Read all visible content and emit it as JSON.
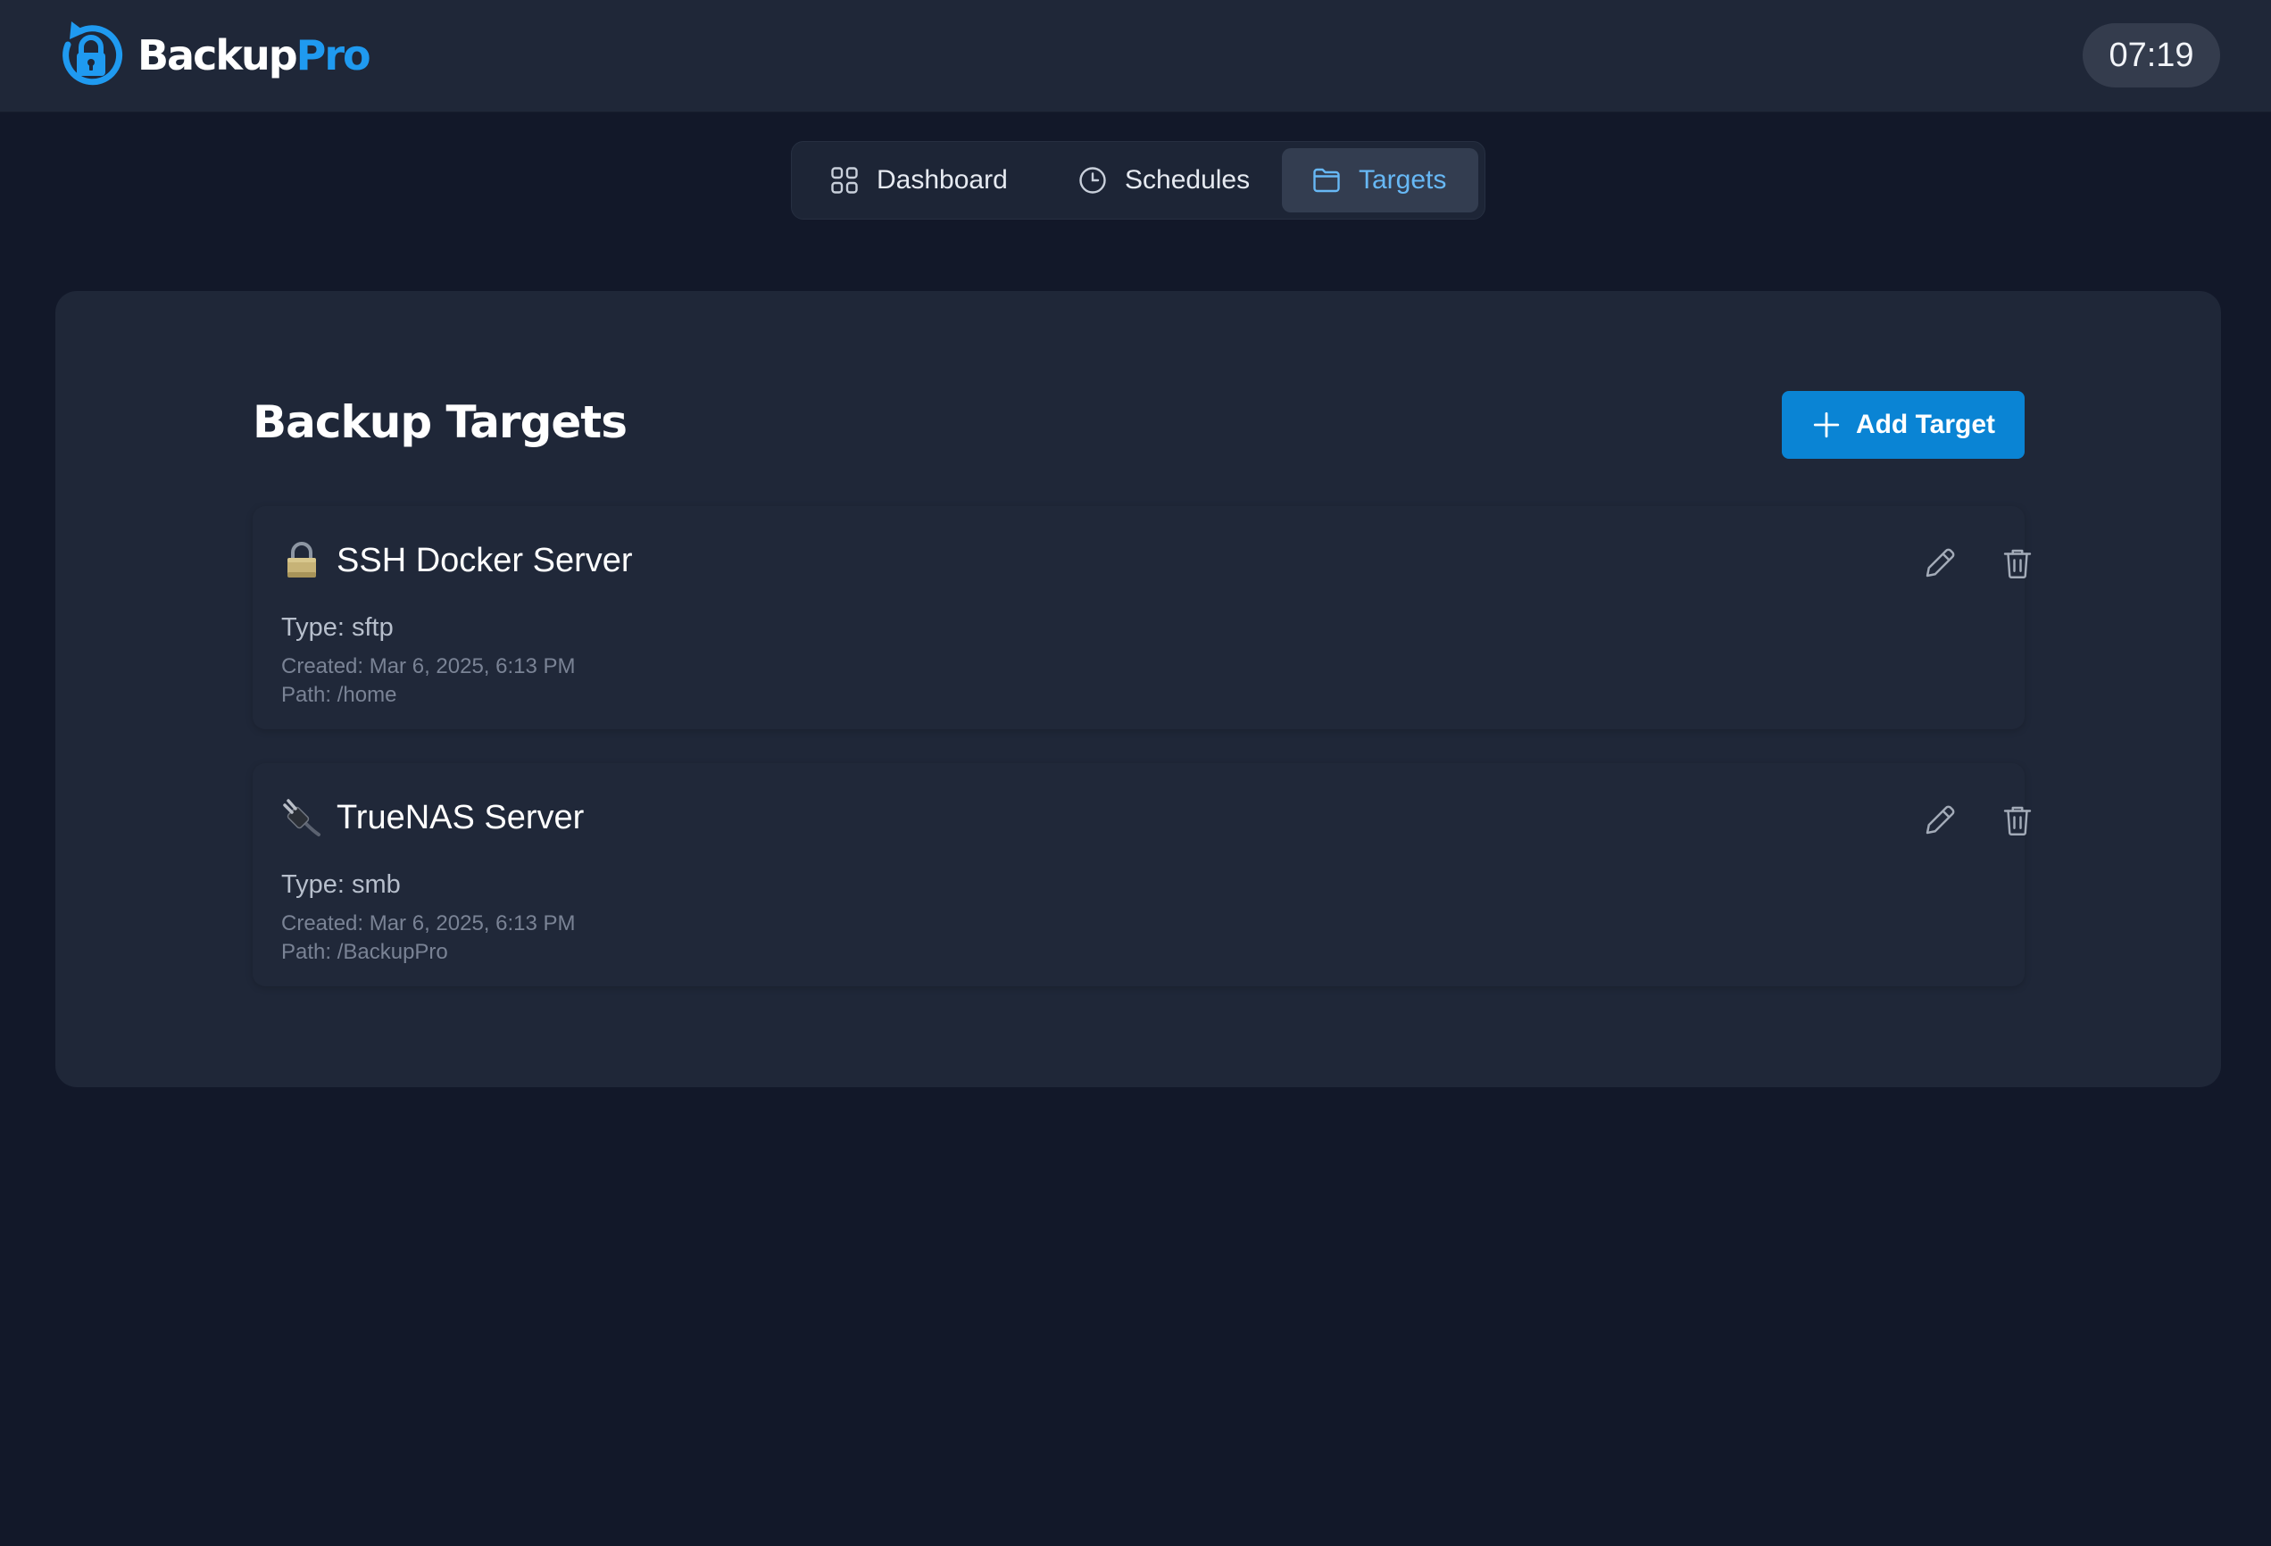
{
  "app": {
    "logo_text_primary": "Backup",
    "logo_text_accent": "Pro",
    "clock": "07:19",
    "colors": {
      "brand": "#1f9af0",
      "background": "#121829",
      "surface": "#1f2738",
      "primary_button": "#0a84d4",
      "active_tab_text": "#67b8f5"
    }
  },
  "nav": {
    "tabs": [
      {
        "label": "Dashboard",
        "icon": "grid-icon",
        "active": false
      },
      {
        "label": "Schedules",
        "icon": "clock-icon",
        "active": false
      },
      {
        "label": "Targets",
        "icon": "folder-icon",
        "active": true
      }
    ]
  },
  "main": {
    "title": "Backup Targets",
    "add_button_label": "Add Target",
    "targets": [
      {
        "emoji": "lock-icon",
        "name": "SSH Docker Server",
        "type": "Type: sftp",
        "created": "Created: Mar 6, 2025, 6:13 PM",
        "path": "Path: /home"
      },
      {
        "emoji": "plug-icon",
        "name": "TrueNAS Server",
        "type": "Type: smb",
        "created": "Created: Mar 6, 2025, 6:13 PM",
        "path": "Path: /BackupPro"
      }
    ]
  }
}
